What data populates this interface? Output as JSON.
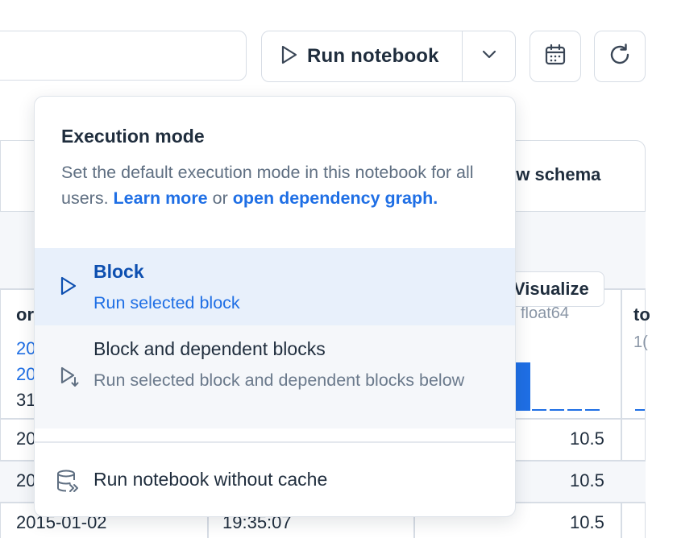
{
  "toolbar": {
    "run_label": "Run notebook",
    "icons": {
      "run": "play-icon",
      "caret": "chevron-down-icon",
      "schedule": "calendar-icon",
      "refresh": "refresh-icon"
    }
  },
  "background": {
    "schema_label": "ew schema",
    "visualize_label": "Visualize",
    "col_partial_1": "or",
    "col_dtype": "float64",
    "col_partial_3": "to",
    "col_partial_3_sub": "1(",
    "link_1": "20",
    "link_2": "20",
    "text_31": "31",
    "rows": [
      {
        "date": "20",
        "value": "10.5"
      },
      {
        "date": "20",
        "value": "10.5"
      },
      {
        "date": "2015-01-02",
        "time": "19:35:07",
        "value": "10.5"
      }
    ],
    "colors": {
      "accent": "#1f6fe5",
      "border": "#d7dde5"
    }
  },
  "menu": {
    "title": "Execution mode",
    "description": "Set the default execution mode in this notebook for all users.",
    "learn_more": "Learn more",
    "or_text": "or",
    "open_graph": "open dependency graph.",
    "options": [
      {
        "title": "Block",
        "subtitle": "Run selected block",
        "icon": "play-icon",
        "selected": true
      },
      {
        "title": "Block and dependent blocks",
        "subtitle": "Run selected block and dependent blocks below",
        "icon": "play-dependent-icon",
        "selected": false
      }
    ],
    "no_cache_label": "Run notebook without cache",
    "no_cache_icon": "database-icon"
  }
}
